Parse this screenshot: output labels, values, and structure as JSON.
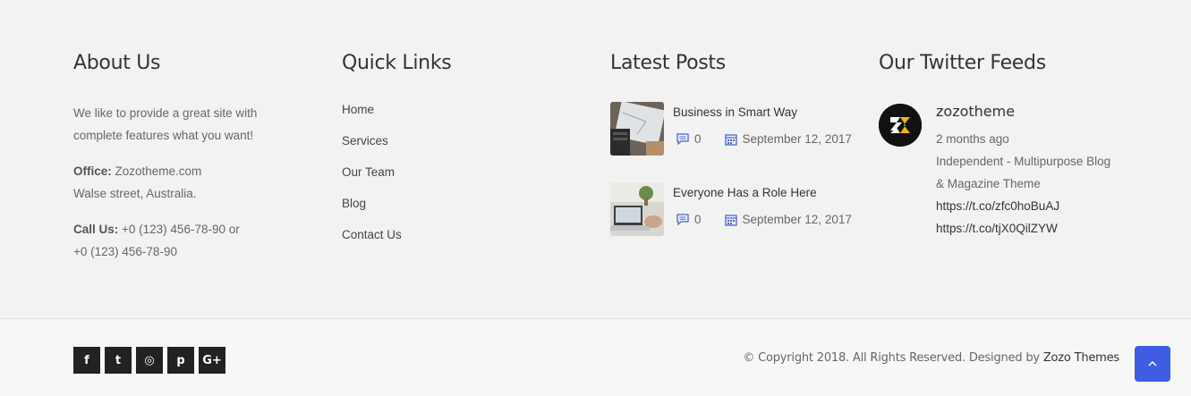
{
  "about": {
    "title": "About Us",
    "desc_line1": "We like to provide a great site with",
    "desc_line2": "complete features what you want!",
    "office_label": "Office:",
    "office_line1": " Zozotheme.com",
    "office_line2": "Walse street, Australia.",
    "call_label": "Call Us:",
    "call_line1": " +0 (123) 456-78-90 or",
    "call_line2": "+0 (123) 456-78-90"
  },
  "quick_links": {
    "title": "Quick Links",
    "items": [
      "Home",
      "Services",
      "Our Team",
      "Blog",
      "Contact Us"
    ]
  },
  "latest_posts": {
    "title": "Latest Posts",
    "posts": [
      {
        "title": "Business in Smart Way",
        "comments": "0",
        "date": "September 12, 2017"
      },
      {
        "title": "Everyone Has a Role Here",
        "comments": "0",
        "date": "September 12, 2017"
      }
    ]
  },
  "twitter": {
    "title": "Our Twitter Feeds",
    "handle": "zozotheme",
    "time": "2 months ago",
    "text_line1": "Independent - Multipurpose Blog",
    "text_line2": "& Magazine Theme",
    "link1": "https://t.co/zfc0hoBuAJ",
    "link2": "https://t.co/tjX0QilZYW"
  },
  "bottom": {
    "social": [
      {
        "icon": "facebook-icon",
        "glyph": "f"
      },
      {
        "icon": "twitter-icon",
        "glyph": "t"
      },
      {
        "icon": "instagram-icon",
        "glyph": "◎"
      },
      {
        "icon": "pinterest-icon",
        "glyph": "p"
      },
      {
        "icon": "google-plus-icon",
        "glyph": "G+"
      }
    ],
    "copyright": "© Copyright 2018. All Rights Reserved. Designed by ",
    "brand": "Zozo Themes"
  },
  "colors": {
    "accent": "#3e5de3",
    "meta_icon": "#4a64d8",
    "social_bg": "#222222"
  }
}
